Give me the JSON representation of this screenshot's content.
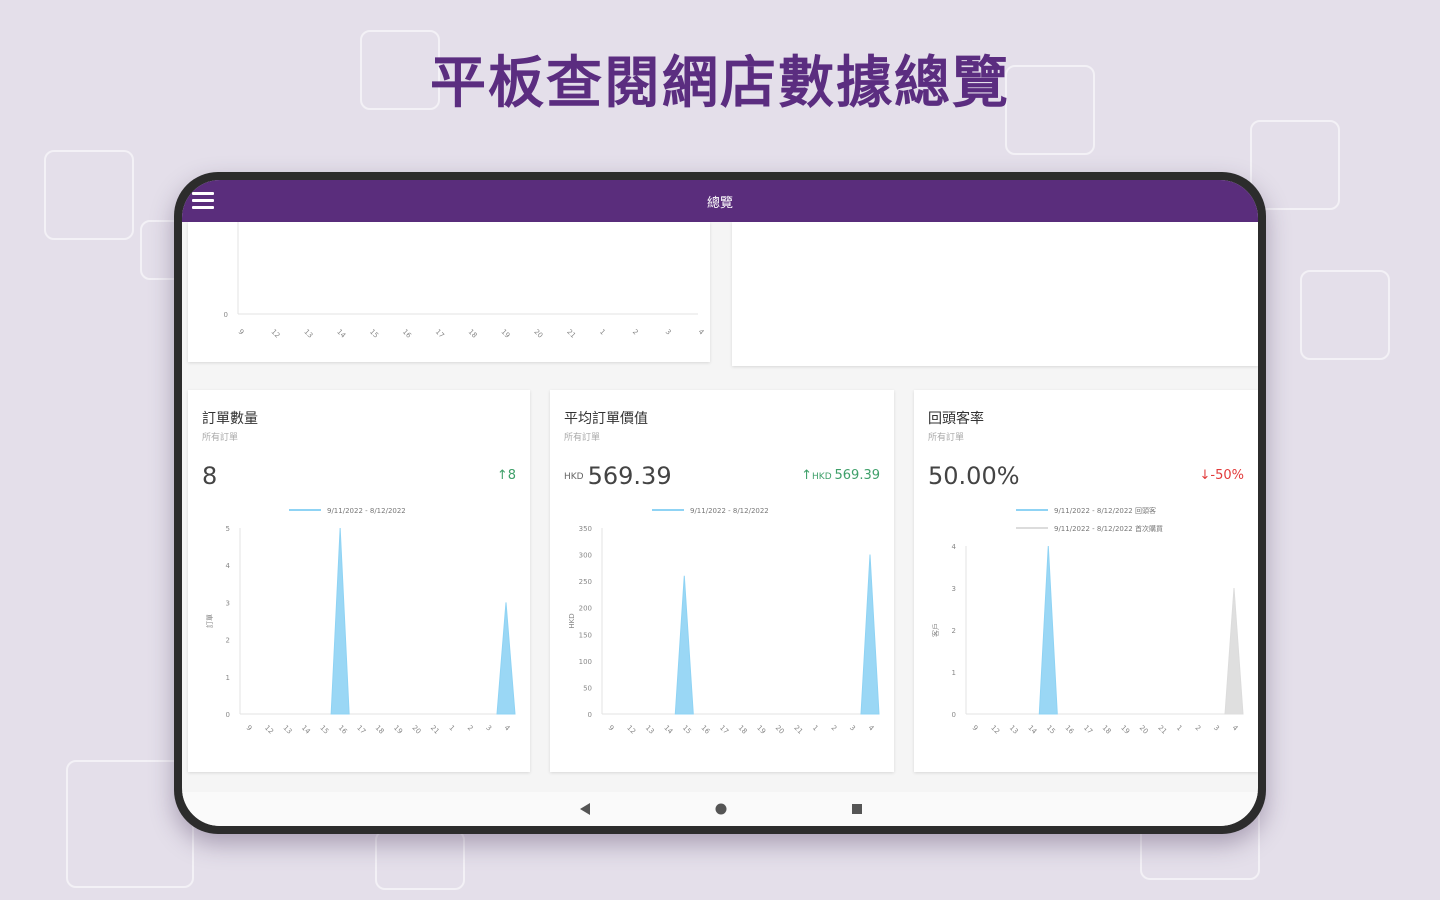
{
  "headline": "平板查閱網店數據總覽",
  "app": {
    "title": "總覽",
    "menu_icon": "hamburger-menu-icon"
  },
  "top_chart": {
    "y_ticks": [
      "0"
    ],
    "x_ticks": [
      "9",
      "12",
      "13",
      "14",
      "15",
      "16",
      "17",
      "18",
      "19",
      "20",
      "21",
      "1",
      "2",
      "3",
      "4"
    ]
  },
  "cards": [
    {
      "title": "訂單數量",
      "subtitle": "所有訂單",
      "value": "8",
      "value_unit": "",
      "delta_arrow": "↑",
      "delta_unit": "",
      "delta": "8",
      "delta_dir": "up",
      "ylabel": "訂單",
      "legend": [
        "9/11/2022 - 8/12/2022"
      ]
    },
    {
      "title": "平均訂單價值",
      "subtitle": "所有訂單",
      "value": "569.39",
      "value_unit": "HKD",
      "delta_arrow": "↑",
      "delta_unit": "HKD ",
      "delta": "569.39",
      "delta_dir": "up",
      "ylabel": "HKD",
      "legend": [
        "9/11/2022 - 8/12/2022"
      ]
    },
    {
      "title": "回頭客率",
      "subtitle": "所有訂單",
      "value": "50.00%",
      "value_unit": "",
      "delta_arrow": "↓",
      "delta_unit": "",
      "delta": "-50%",
      "delta_dir": "down",
      "ylabel": "客戶",
      "legend": [
        "9/11/2022 - 8/12/2022 回頭客",
        "9/11/2022 - 8/12/2022 首次購買"
      ]
    }
  ],
  "chart_data": [
    {
      "type": "area",
      "title": "訂單數量",
      "ylabel": "訂單",
      "x": [
        "9",
        "12",
        "13",
        "14",
        "15",
        "16",
        "17",
        "18",
        "19",
        "20",
        "21",
        "1",
        "2",
        "3",
        "4"
      ],
      "ylim": [
        0,
        5
      ],
      "y_ticks": [
        0,
        1,
        2,
        3,
        4,
        5
      ],
      "series": [
        {
          "name": "9/11/2022 - 8/12/2022",
          "values": [
            0,
            0,
            0,
            0,
            0,
            5,
            0,
            0,
            0,
            0,
            0,
            0,
            0,
            0,
            3
          ],
          "color": "#8fd3f4"
        }
      ]
    },
    {
      "type": "area",
      "title": "平均訂單價值",
      "ylabel": "HKD",
      "x": [
        "9",
        "12",
        "13",
        "14",
        "15",
        "16",
        "17",
        "18",
        "19",
        "20",
        "21",
        "1",
        "2",
        "3",
        "4"
      ],
      "ylim": [
        0,
        350
      ],
      "y_ticks": [
        0,
        50,
        100,
        150,
        200,
        250,
        300,
        350
      ],
      "series": [
        {
          "name": "9/11/2022 - 8/12/2022",
          "values": [
            0,
            0,
            0,
            0,
            260,
            0,
            0,
            0,
            0,
            0,
            0,
            0,
            0,
            0,
            300
          ],
          "color": "#8fd3f4"
        }
      ]
    },
    {
      "type": "area",
      "title": "回頭客率",
      "ylabel": "客戶",
      "x": [
        "9",
        "12",
        "13",
        "14",
        "15",
        "16",
        "17",
        "18",
        "19",
        "20",
        "21",
        "1",
        "2",
        "3",
        "4"
      ],
      "ylim": [
        0,
        4
      ],
      "y_ticks": [
        0,
        1,
        2,
        3,
        4
      ],
      "series": [
        {
          "name": "9/11/2022 - 8/12/2022 回頭客",
          "values": [
            0,
            0,
            0,
            0,
            4,
            0,
            0,
            0,
            0,
            0,
            0,
            0,
            0,
            0,
            0
          ],
          "color": "#8fd3f4"
        },
        {
          "name": "9/11/2022 - 8/12/2022 首次購買",
          "values": [
            0,
            0,
            0,
            0,
            0,
            0,
            0,
            0,
            0,
            0,
            0,
            0,
            0,
            0,
            3
          ],
          "color": "#dcdcdc"
        }
      ]
    }
  ],
  "nav": {
    "back_icon": "back-triangle-icon",
    "home_icon": "home-circle-icon",
    "recents_icon": "recents-square-icon"
  }
}
